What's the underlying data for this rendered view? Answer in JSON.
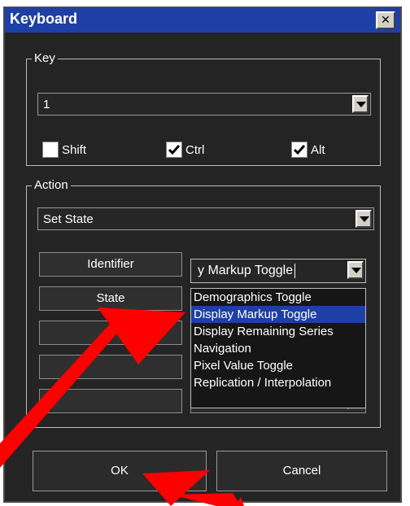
{
  "window": {
    "title": "Keyboard",
    "close_glyph": "✕"
  },
  "key_group": {
    "legend": "Key",
    "key_value": "1",
    "modifiers": [
      {
        "label": "Shift",
        "checked": false
      },
      {
        "label": "Ctrl",
        "checked": true
      },
      {
        "label": "Alt",
        "checked": true
      }
    ]
  },
  "action_group": {
    "legend": "Action",
    "action_value": "Set State",
    "parameter_buttons": [
      "Identifier",
      "State",
      "",
      "",
      ""
    ],
    "identifier_value": "y Markup Toggle",
    "identifier_options": [
      {
        "label": "Demographics Toggle",
        "selected": false
      },
      {
        "label": "Display Markup Toggle",
        "selected": true
      },
      {
        "label": "Display Remaining Series",
        "selected": false
      },
      {
        "label": "Navigation",
        "selected": false
      },
      {
        "label": "Pixel Value Toggle",
        "selected": false
      },
      {
        "label": "Replication / Interpolation",
        "selected": false
      }
    ]
  },
  "buttons": {
    "ok": "OK",
    "cancel": "Cancel"
  },
  "colors": {
    "title_bar": "#1e3fa5",
    "background": "#242424",
    "selected_item": "#1e3fa5",
    "annotation_arrow": "#ff0000"
  },
  "icons": {
    "dropdown": "chevron-down-icon",
    "checkmark": "checkmark-icon",
    "close": "close-icon",
    "annotation": "red-arrow-annotation"
  }
}
